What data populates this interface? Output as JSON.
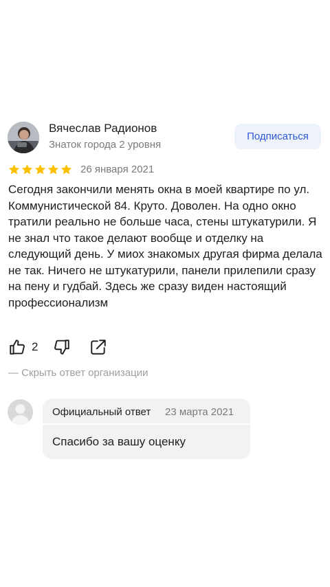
{
  "author": {
    "name": "Вячеслав Радионов",
    "level": "Знаток города 2 уровня",
    "subscribe_label": "Подписаться"
  },
  "review": {
    "rating": 5,
    "rating_max": 5,
    "date": "26 января 2021",
    "text": "Сегодня закончили менять окна в моей квартире по ул. Коммунистической 84. Круто. Доволен. На одно окно тратили реально не больше часа, стены штукатурили. Я не знал что такое делают вообще и отделку на следующий день. У миох знакомых другая фирма делала не так. Ничего не штукатурили, панели прилепили сразу на пену и гудбай. Здесь же сразу виден настоящий профессионализм",
    "likes": "2"
  },
  "hide_answer_label": "— Скрыть ответ организации",
  "org_answer": {
    "label": "Официальный ответ",
    "date": "23 марта 2021",
    "text": "Спасибо за вашу оценку"
  },
  "colors": {
    "star": "#fcc000",
    "accent": "#2e58d6",
    "subscribe_bg": "#eef2fb",
    "answer_bg": "#f2f2f2"
  },
  "icons": [
    "user-photo",
    "star-icon",
    "thumb-up-icon",
    "thumb-down-icon",
    "share-icon",
    "org-avatar-icon"
  ]
}
